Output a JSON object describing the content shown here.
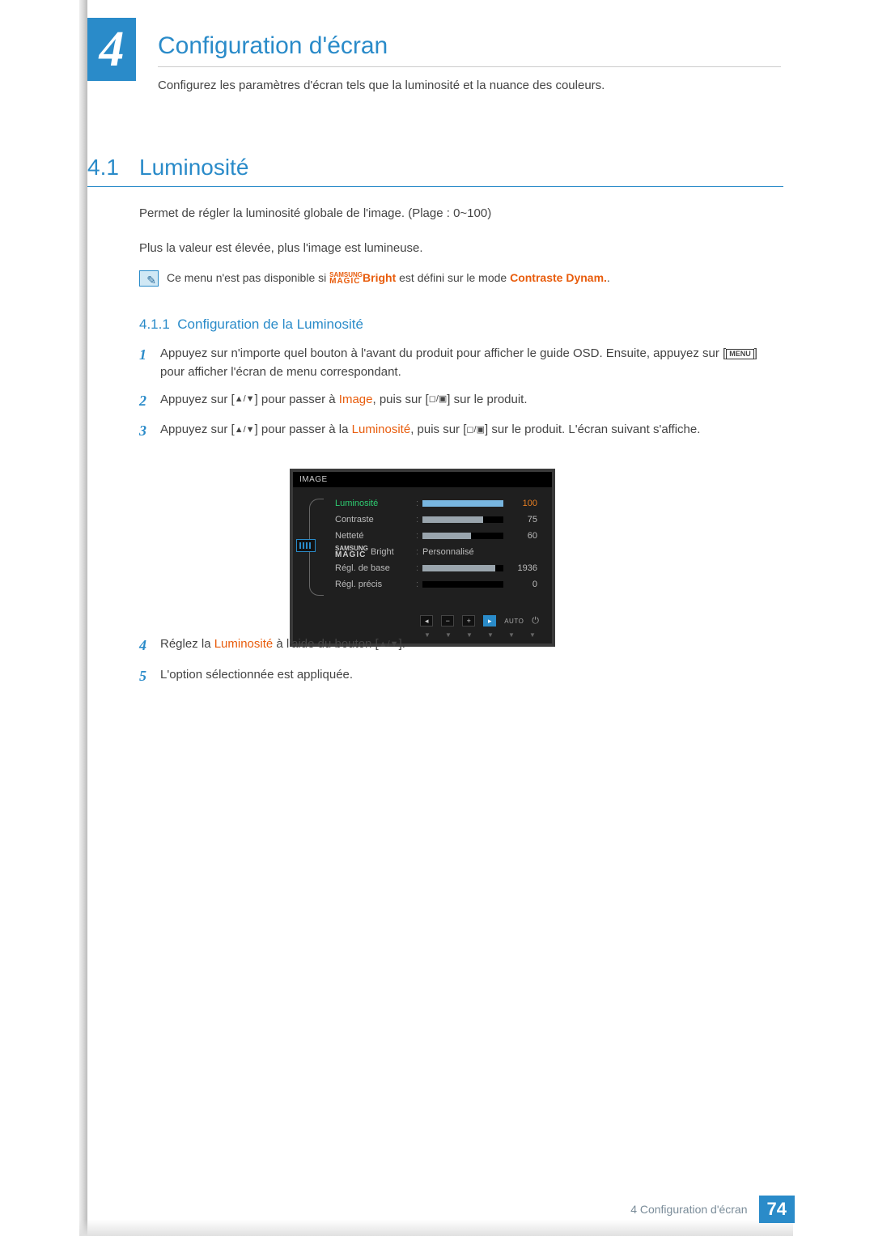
{
  "chapter": {
    "number": "4",
    "title": "Configuration d'écran",
    "intro": "Configurez les paramètres d'écran tels que la luminosité et la nuance des couleurs."
  },
  "section": {
    "num": "4.1",
    "title": "Luminosité",
    "p1": "Permet de régler la luminosité globale de l'image. (Plage : 0~100)",
    "p2": "Plus la valeur est élevée, plus l'image est lumineuse.",
    "note_pre": "Ce menu n'est pas disponible si ",
    "note_brand_top": "SAMSUNG",
    "note_brand_bottom": "MAGIC",
    "note_bright": "Bright",
    "note_mid": " est défini sur le mode ",
    "note_cd": "Contraste Dynam.",
    "note_dot": "."
  },
  "subsection": {
    "num": "4.1.1",
    "title": "Configuration de la Luminosité"
  },
  "steps": {
    "s1n": "1",
    "s1a": "Appuyez sur n'importe quel bouton à l'avant du produit pour afficher le guide OSD. Ensuite, appuyez sur [",
    "s1menu": "MENU",
    "s1b": "] pour afficher l'écran de menu correspondant.",
    "s2n": "2",
    "s2a": "Appuyez sur [",
    "s2b": "] pour passer à ",
    "s2img": "Image",
    "s2c": ", puis sur [",
    "s2d": "] sur le produit.",
    "s3n": "3",
    "s3a": "Appuyez sur [",
    "s3b": "] pour passer à la ",
    "s3lum": "Luminosité",
    "s3c": ", puis sur [",
    "s3d": "] sur le produit. L'écran suivant s'affiche.",
    "s4n": "4",
    "s4a": "Réglez la ",
    "s4lum": "Luminosité",
    "s4b": " à l'aide du bouton [",
    "s4c": "].",
    "s5n": "5",
    "s5": "L'option sélectionnée est appliquée."
  },
  "osd": {
    "header": "IMAGE",
    "rows": [
      {
        "label": "Luminosité",
        "value": "100",
        "fill": 100,
        "active": true
      },
      {
        "label": "Contraste",
        "value": "75",
        "fill": 75,
        "active": false
      },
      {
        "label": "Netteté",
        "value": "60",
        "fill": 60,
        "active": false
      },
      {
        "label_pre": "SAMSUNG",
        "label_sub": "MAGIC",
        "label_suf": " Bright",
        "text": "Personnalisé",
        "active": false
      },
      {
        "label": "Régl. de base",
        "value": "1936",
        "fill": 90,
        "active": false
      },
      {
        "label": "Régl. précis",
        "value": "0",
        "fill": 0,
        "active": false
      }
    ],
    "btn_left": "◂",
    "btn_minus": "−",
    "btn_plus": "+",
    "btn_play": "▸",
    "auto": "AUTO",
    "power": "⏻"
  },
  "footer": {
    "text": "4 Configuration d'écran",
    "page": "74"
  }
}
